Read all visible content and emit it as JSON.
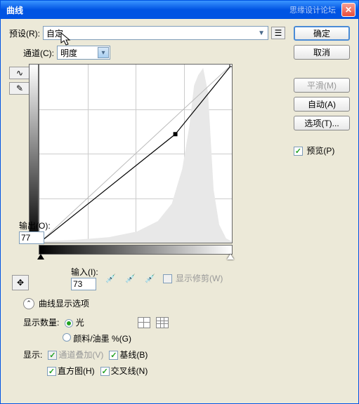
{
  "title": "曲线",
  "watermark": "思缘设计论坛",
  "preset": {
    "label": "预设(R):",
    "value": "自定"
  },
  "channel": {
    "label": "通道(C):",
    "value": "明度"
  },
  "output": {
    "label": "输出(O):",
    "value": "77"
  },
  "input": {
    "label": "输入(I):",
    "value": "73"
  },
  "show_clipping": "显示修剪(W)",
  "display_section": "曲线显示选项",
  "display_amount": {
    "label": "显示数量:",
    "light": "光",
    "pigment": "颜料/油墨 %(G)"
  },
  "show": {
    "label": "显示:",
    "channel_overlay": "通道叠加(V)",
    "baseline": "基线(B)",
    "histogram": "直方图(H)",
    "intersection": "交叉线(N)"
  },
  "buttons": {
    "ok": "确定",
    "cancel": "取消",
    "smooth": "平滑(M)",
    "auto": "自动(A)",
    "options": "选项(T)...",
    "preview": "预览(P)"
  },
  "chart_data": {
    "type": "line",
    "title": "",
    "xlim": [
      0,
      255
    ],
    "ylim": [
      0,
      255
    ],
    "grid": [
      4,
      4
    ],
    "series": [
      {
        "name": "baseline",
        "points": [
          [
            0,
            0
          ],
          [
            255,
            255
          ]
        ]
      },
      {
        "name": "curve",
        "points": [
          [
            0,
            0
          ],
          [
            180,
            155
          ],
          [
            255,
            255
          ]
        ]
      }
    ],
    "selected_point": {
      "input": 73,
      "output": 77
    }
  }
}
